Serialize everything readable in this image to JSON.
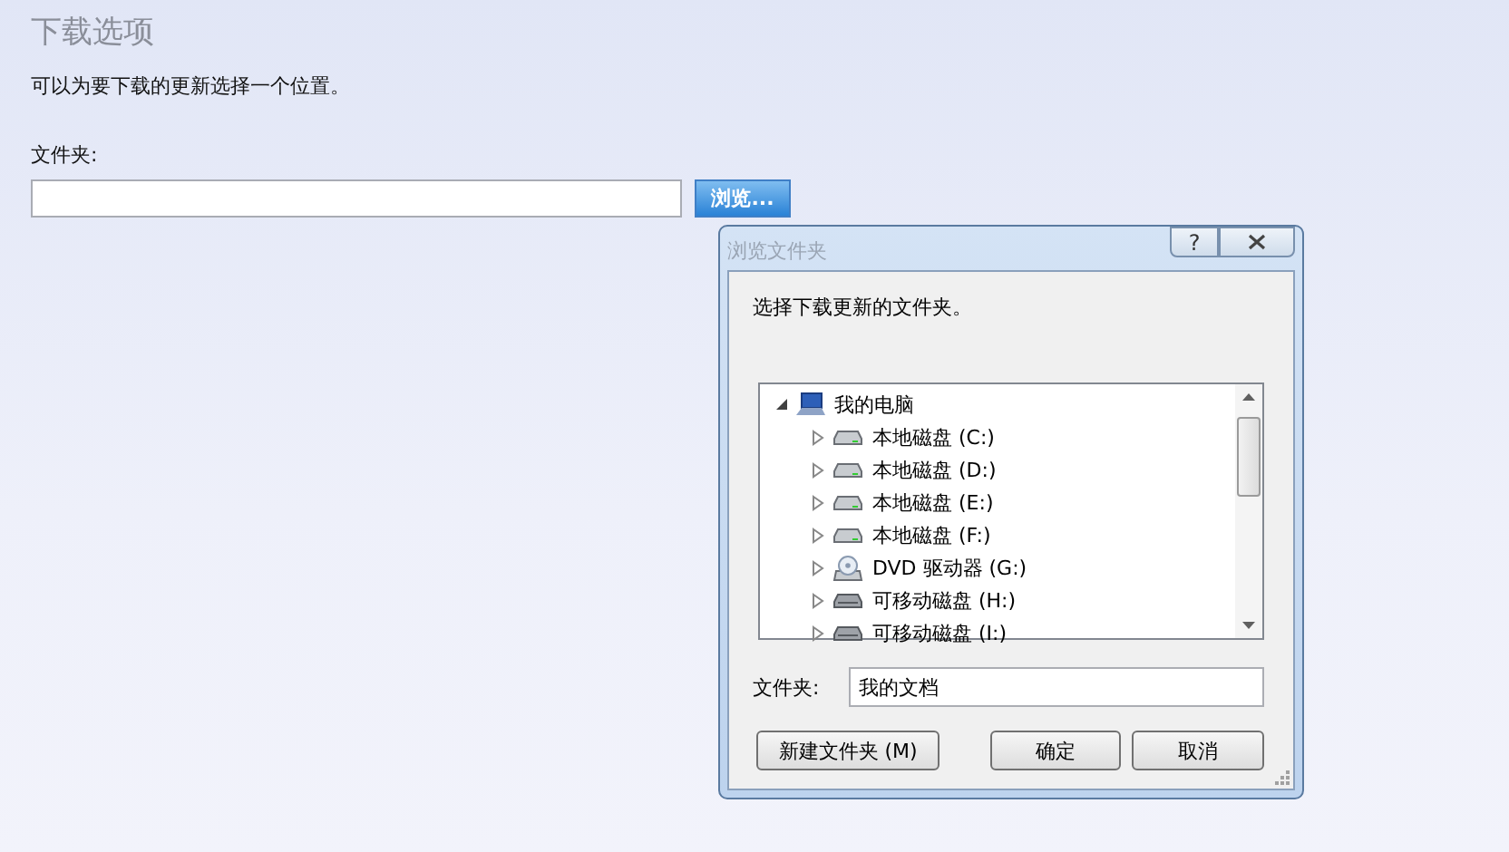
{
  "page": {
    "title": "下载选项",
    "description": "可以为要下载的更新选择一个位置。",
    "folder_label": "文件夹:",
    "browse_button": "浏览..."
  },
  "dialog": {
    "title": "浏览文件夹",
    "help_button": "?",
    "prompt": "选择下载更新的文件夹。",
    "tree": [
      {
        "label": "我的电脑",
        "kind": "computer",
        "expanded": true,
        "children": [
          {
            "label": "本地磁盘 (C:)",
            "kind": "drive",
            "expanded": false
          },
          {
            "label": "本地磁盘 (D:)",
            "kind": "drive",
            "expanded": false
          },
          {
            "label": "本地磁盘 (E:)",
            "kind": "drive",
            "expanded": false
          },
          {
            "label": "本地磁盘 (F:)",
            "kind": "drive",
            "expanded": false
          },
          {
            "label": "DVD 驱动器 (G:)",
            "kind": "dvd",
            "expanded": false
          },
          {
            "label": "可移动磁盘 (H:)",
            "kind": "removable",
            "expanded": false
          },
          {
            "label": "可移动磁盘 (I:)",
            "kind": "removable",
            "expanded": false
          }
        ]
      }
    ],
    "folder_label": "文件夹:",
    "folder_value": "我的文档",
    "buttons": [
      "新建文件夹 (M)",
      "确定",
      "取消"
    ]
  }
}
